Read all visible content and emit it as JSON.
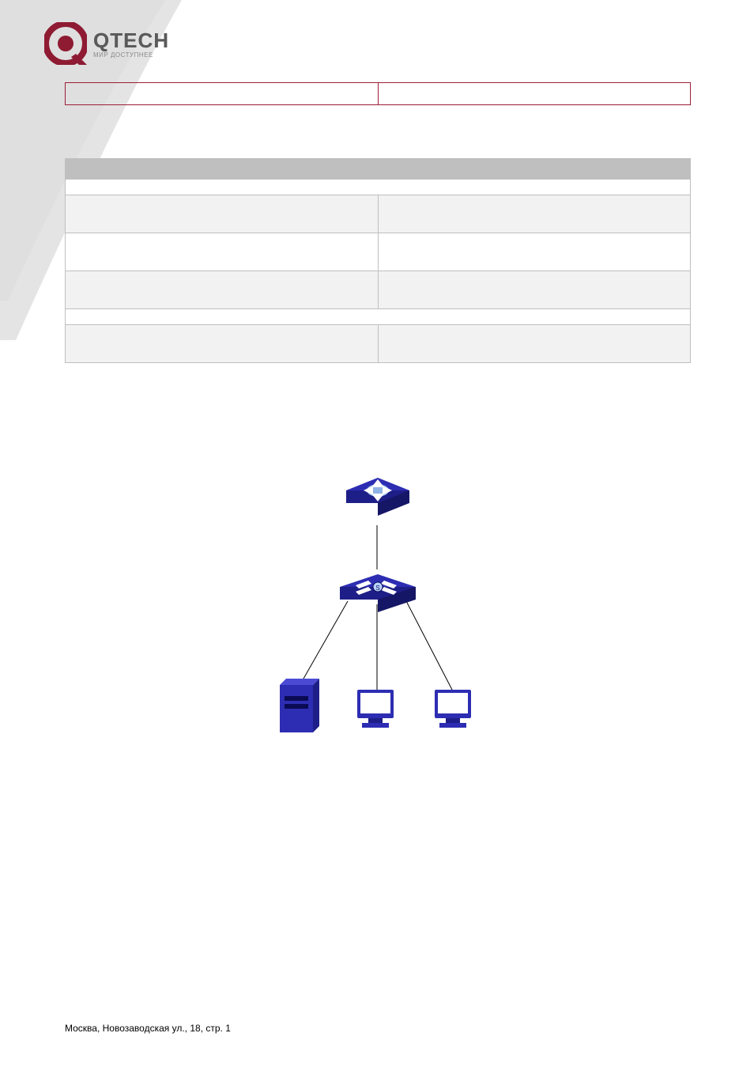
{
  "logo": {
    "brand": "QTECH",
    "tagline": "МИР ДОСТУПНЕЕ"
  },
  "header_row": {
    "left": "",
    "right": ""
  },
  "cmd_table": {
    "headers": {
      "left": "",
      "right": ""
    },
    "group1_label": "",
    "rows": [
      {
        "cmd": "",
        "desc": ""
      },
      {
        "cmd": "",
        "desc": ""
      },
      {
        "cmd": "",
        "desc": ""
      }
    ],
    "group2_label": "",
    "rows2": [
      {
        "cmd": "",
        "desc": ""
      }
    ]
  },
  "footer_address": "Москва, Новозаводская ул., 18, стр. 1",
  "chart_data": {
    "type": "diagram",
    "title": "",
    "nodes": [
      {
        "id": "router",
        "label": "",
        "type": "router-icon"
      },
      {
        "id": "switch",
        "label": "",
        "type": "switch-icon"
      },
      {
        "id": "server",
        "label": "",
        "type": "server-icon"
      },
      {
        "id": "pc1",
        "label": "",
        "type": "pc-icon"
      },
      {
        "id": "pc2",
        "label": "",
        "type": "pc-icon"
      }
    ],
    "edges": [
      {
        "from": "router",
        "to": "switch"
      },
      {
        "from": "switch",
        "to": "server"
      },
      {
        "from": "switch",
        "to": "pc1"
      },
      {
        "from": "switch",
        "to": "pc2"
      }
    ]
  },
  "colors": {
    "accent": "#9a1e37",
    "device": "#2d2db3"
  }
}
